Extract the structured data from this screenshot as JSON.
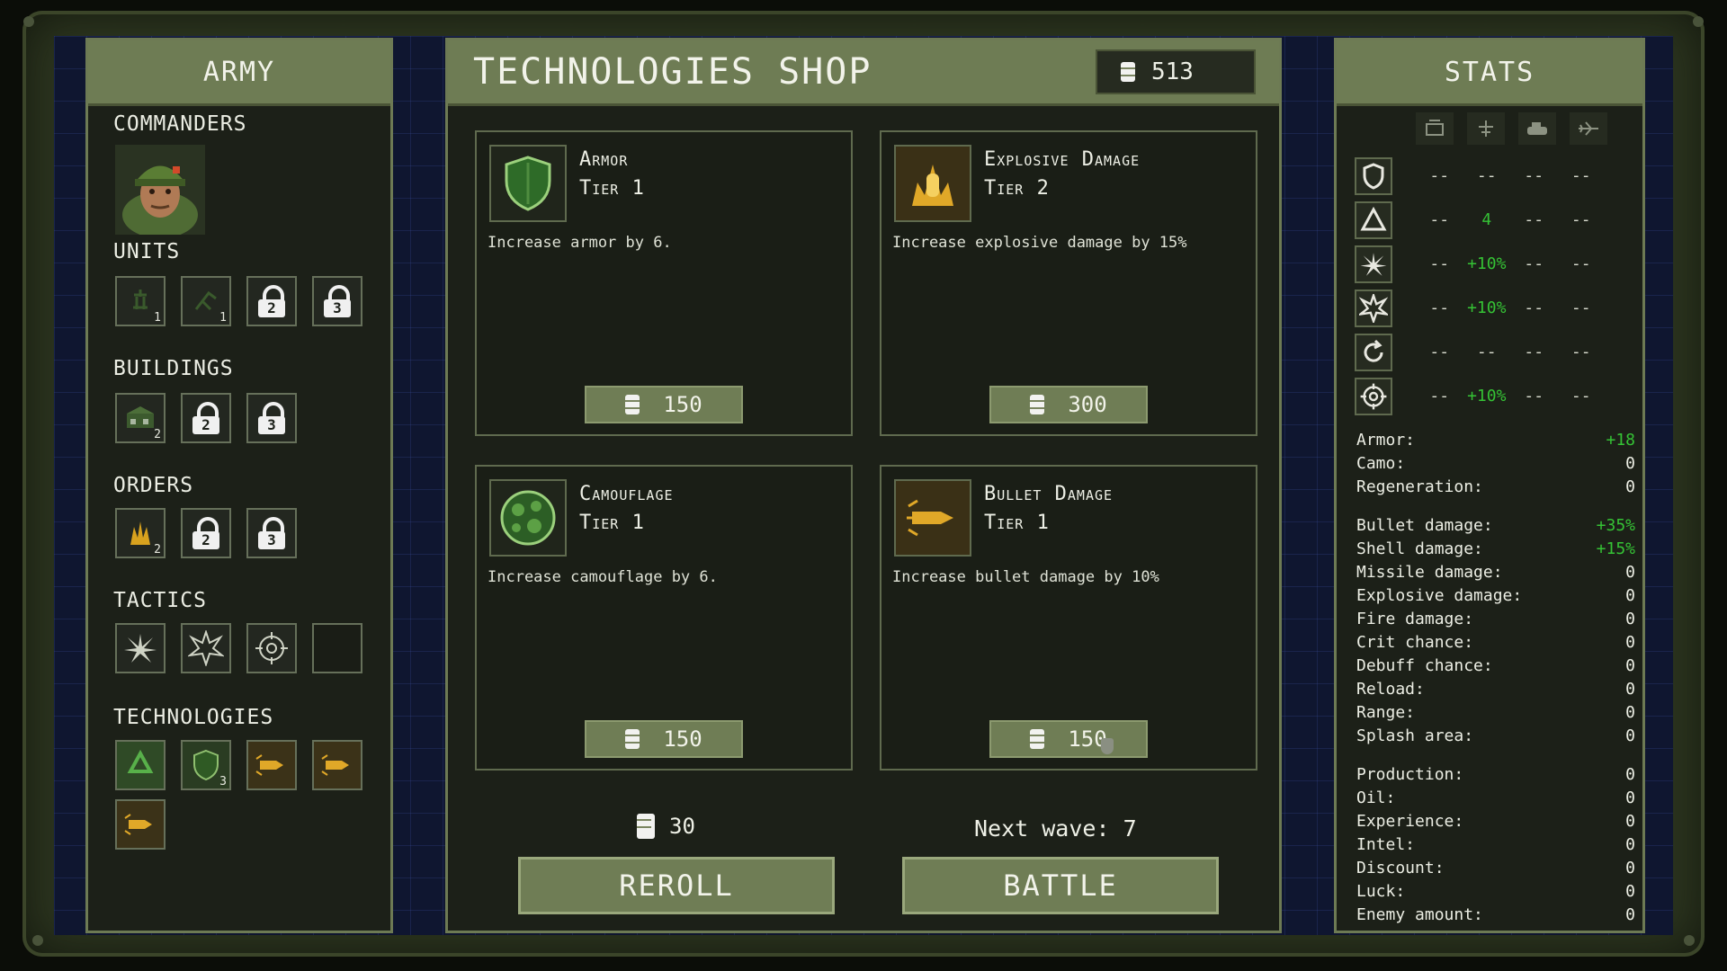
{
  "army": {
    "title": "ARMY",
    "commanders_label": "COMMANDERS",
    "units_label": "UNITS",
    "units": [
      {
        "icon": "soldier-unit-icon",
        "badge": "1"
      },
      {
        "icon": "sniper-unit-icon",
        "badge": "1"
      },
      {
        "icon": "lock-icon",
        "badge": "2"
      },
      {
        "icon": "lock-icon",
        "badge": "3"
      }
    ],
    "buildings_label": "BUILDINGS",
    "buildings": [
      {
        "icon": "barracks-building-icon",
        "badge": "2"
      },
      {
        "icon": "lock-icon",
        "badge": "2"
      },
      {
        "icon": "lock-icon",
        "badge": "3"
      }
    ],
    "orders_label": "ORDERS",
    "orders": [
      {
        "icon": "fire-order-icon",
        "badge": "2"
      },
      {
        "icon": "lock-icon",
        "badge": "2"
      },
      {
        "icon": "lock-icon",
        "badge": "3"
      }
    ],
    "tactics_label": "TACTICS",
    "tactics": [
      "burst-icon",
      "star-burst-icon",
      "crosshair-icon",
      "empty-slot"
    ],
    "technologies_label": "TECHNOLOGIES",
    "technologies": [
      {
        "icon": "recycle-tech-icon",
        "badge": ""
      },
      {
        "icon": "shield-tech-icon",
        "badge": "3"
      },
      {
        "icon": "bullet-tech-icon",
        "badge": ""
      },
      {
        "icon": "bullet-tech-icon",
        "badge": ""
      },
      {
        "icon": "bullet-tech-icon",
        "badge": ""
      }
    ]
  },
  "shop": {
    "title": "TECHNOLOGIES SHOP",
    "oil": "513",
    "cards": [
      {
        "name": "Armor",
        "tier": "Tier 1",
        "desc": "Increase armor by 6.",
        "price": "150",
        "icon": "shield-icon"
      },
      {
        "name": "Explosive Damage",
        "tier": "Tier 2",
        "desc": "Increase explosive damage by 15%",
        "price": "300",
        "icon": "explosion-icon"
      },
      {
        "name": "Camouflage",
        "tier": "Tier 1",
        "desc": "Increase camouflage by 6.",
        "price": "150",
        "icon": "camouflage-icon"
      },
      {
        "name": "Bullet Damage",
        "tier": "Tier 1",
        "desc": "Increase bullet damage by 10%",
        "price": "150",
        "icon": "bullet-icon"
      }
    ],
    "reroll_cost": "30",
    "reroll_label": "REROLL",
    "next_wave": "Next wave: 7",
    "battle_label": "BATTLE"
  },
  "stats": {
    "title": "STATS",
    "columns": [
      "infantry-icon",
      "sniper-icon",
      "tank-icon",
      "plane-icon"
    ],
    "rows": [
      {
        "icon": "shield-icon",
        "values": [
          "--",
          "--",
          "--",
          "--"
        ]
      },
      {
        "icon": "recycle-icon",
        "values": [
          "--",
          "4",
          "--",
          "--"
        ]
      },
      {
        "icon": "burst-icon",
        "values": [
          "--",
          "+10%",
          "--",
          "--"
        ]
      },
      {
        "icon": "star-burst-icon",
        "values": [
          "--",
          "+10%",
          "--",
          "--"
        ]
      },
      {
        "icon": "reload-icon",
        "values": [
          "--",
          "--",
          "--",
          "--"
        ]
      },
      {
        "icon": "crosshair-icon",
        "values": [
          "--",
          "+10%",
          "--",
          "--"
        ]
      }
    ],
    "group1": [
      {
        "label": "Armor:",
        "value": "+18",
        "green": true
      },
      {
        "label": "Camo:",
        "value": "0",
        "green": false
      },
      {
        "label": "Regeneration:",
        "value": "0",
        "green": false
      }
    ],
    "group2": [
      {
        "label": "Bullet damage:",
        "value": "+35%",
        "green": true
      },
      {
        "label": "Shell damage:",
        "value": "+15%",
        "green": true
      },
      {
        "label": "Missile damage:",
        "value": "0",
        "green": false
      },
      {
        "label": "Explosive damage:",
        "value": "0",
        "green": false
      },
      {
        "label": "Fire damage:",
        "value": "0",
        "green": false
      },
      {
        "label": "Crit chance:",
        "value": "0",
        "green": false
      },
      {
        "label": "Debuff chance:",
        "value": "0",
        "green": false
      },
      {
        "label": "Reload:",
        "value": "0",
        "green": false
      },
      {
        "label": "Range:",
        "value": "0",
        "green": false
      },
      {
        "label": "Splash area:",
        "value": "0",
        "green": false
      }
    ],
    "group3": [
      {
        "label": "Production:",
        "value": "0",
        "green": false
      },
      {
        "label": "Oil:",
        "value": "0",
        "green": false
      },
      {
        "label": "Experience:",
        "value": "0",
        "green": false
      },
      {
        "label": "Intel:",
        "value": "0",
        "green": false
      },
      {
        "label": "Discount:",
        "value": "0",
        "green": false
      },
      {
        "label": "Luck:",
        "value": "0",
        "green": false
      },
      {
        "label": "Enemy amount:",
        "value": "0",
        "green": false
      }
    ]
  }
}
